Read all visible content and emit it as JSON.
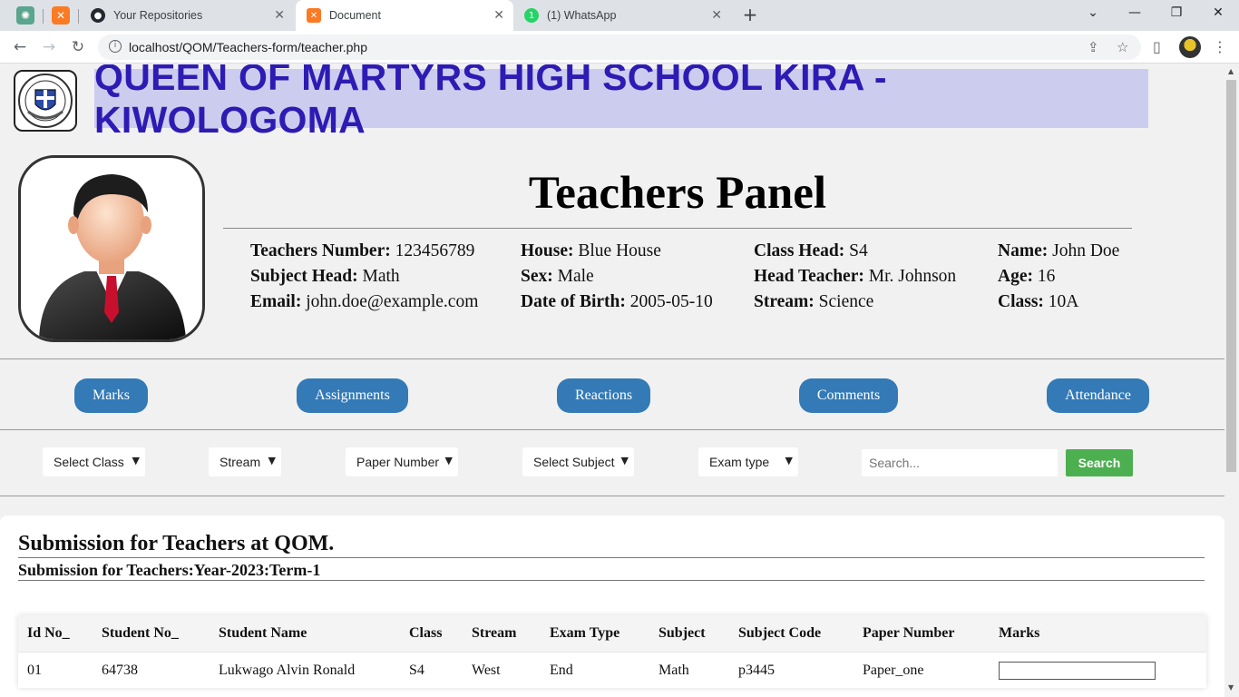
{
  "browser": {
    "tabs": [
      {
        "title": "Your Repositories"
      },
      {
        "title": "Document"
      },
      {
        "title": "(1) WhatsApp"
      }
    ],
    "url": "localhost/QOM/Teachers-form/teacher.php"
  },
  "header": {
    "school_name": "QUEEN OF MARTYRS HIGH SCHOOL KIRA - KIWOLOGOMA",
    "panel_title": "Teachers Panel"
  },
  "profile": {
    "fields": [
      {
        "label": "Teachers Number:",
        "value": "123456789"
      },
      {
        "label": "Subject Head:",
        "value": "Math"
      },
      {
        "label": "Email:",
        "value": "john.doe@example.com"
      },
      {
        "label": "House:",
        "value": "Blue House"
      },
      {
        "label": "Sex:",
        "value": "Male"
      },
      {
        "label": "Date of Birth:",
        "value": "2005-05-10"
      },
      {
        "label": "Class Head:",
        "value": "S4"
      },
      {
        "label": "Head Teacher:",
        "value": "Mr. Johnson"
      },
      {
        "label": "Stream:",
        "value": "Science"
      },
      {
        "label": "Name:",
        "value": "John Doe"
      },
      {
        "label": "Age:",
        "value": "16"
      },
      {
        "label": "Class:",
        "value": "10A"
      }
    ]
  },
  "nav": {
    "buttons": [
      "Marks",
      "Assignments",
      "Reactions",
      "Comments",
      "Attendance"
    ]
  },
  "filters": {
    "selects": [
      "Select Class",
      "Stream",
      "Paper Number",
      "Select Subject",
      "Exam type"
    ],
    "search_placeholder": "Search...",
    "search_button": "Search"
  },
  "submission": {
    "title": "Submission for Teachers at QOM.",
    "subtitle": "Submission for Teachers:Year-2023:Term-1",
    "columns": [
      "Id No_",
      "Student No_",
      "Student Name",
      "Class",
      "Stream",
      "Exam Type",
      "Subject",
      "Subject Code",
      "Paper Number",
      "Marks"
    ],
    "rows": [
      [
        "01",
        "64738",
        "Lukwago Alvin Ronald",
        "S4",
        "West",
        "End",
        "Math",
        "p3445",
        "Paper_one",
        ""
      ]
    ]
  }
}
